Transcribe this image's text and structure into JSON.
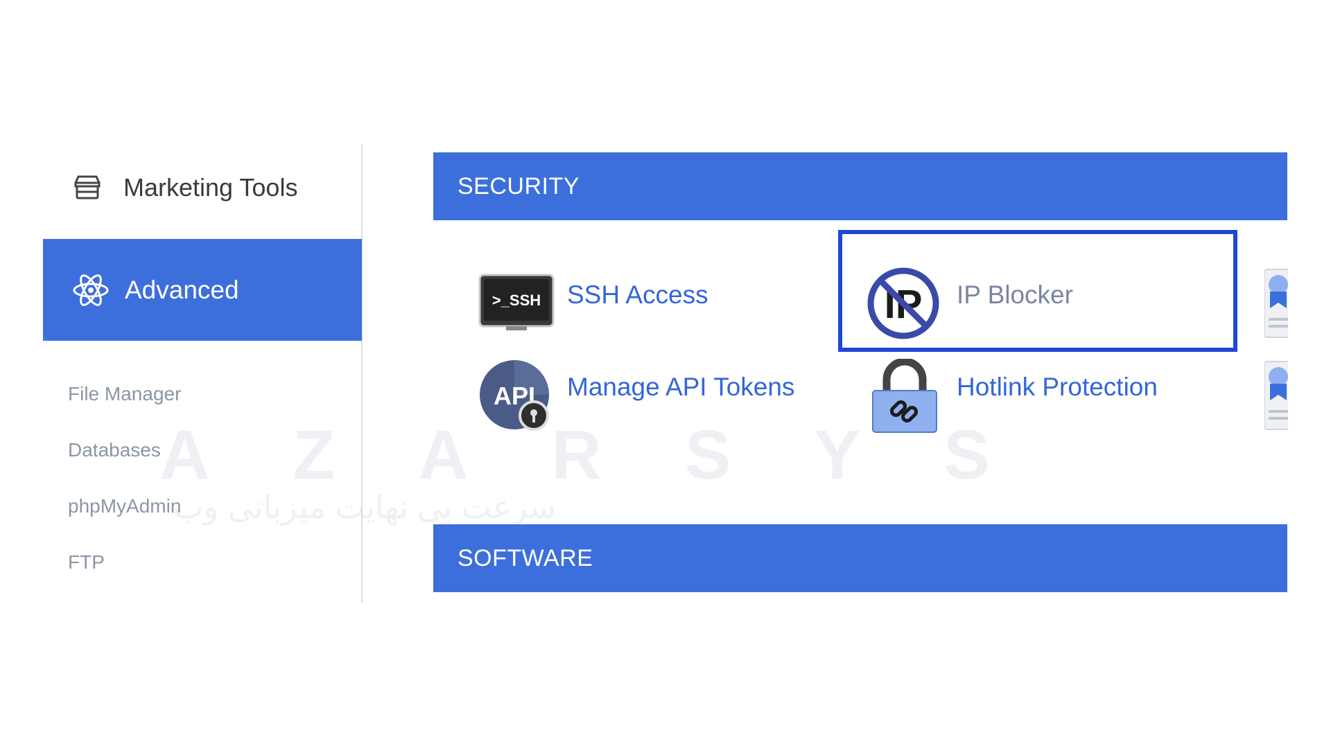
{
  "sidebar": {
    "top_item": {
      "label": "Marketing Tools",
      "icon": "store-icon"
    },
    "active_item": {
      "label": "Advanced",
      "icon": "atom-icon"
    },
    "sub_items": [
      {
        "label": "File Manager"
      },
      {
        "label": "Databases"
      },
      {
        "label": "phpMyAdmin"
      },
      {
        "label": "FTP"
      }
    ]
  },
  "sections": {
    "security": {
      "title": "SECURITY"
    },
    "software": {
      "title": "SOFTWARE"
    }
  },
  "tools": [
    {
      "label": "SSH Access",
      "icon": "ssh-terminal-icon",
      "icon_text": ">_SSH"
    },
    {
      "label": "IP Blocker",
      "icon": "ip-blocker-icon",
      "icon_text": "IP",
      "highlighted": true
    },
    {
      "label": "Manage API Tokens",
      "icon": "api-token-icon",
      "icon_text": "API"
    },
    {
      "label": "Hotlink Protection",
      "icon": "padlock-link-icon"
    }
  ],
  "watermark": {
    "latin": "AZARSYS",
    "persian": "سرعت بی نهایت میزبانی وب"
  },
  "colors": {
    "accent": "#3d6fdc",
    "highlight_border": "#2046d8",
    "link": "#3366d6",
    "sidebar_text": "#8a96a6"
  }
}
